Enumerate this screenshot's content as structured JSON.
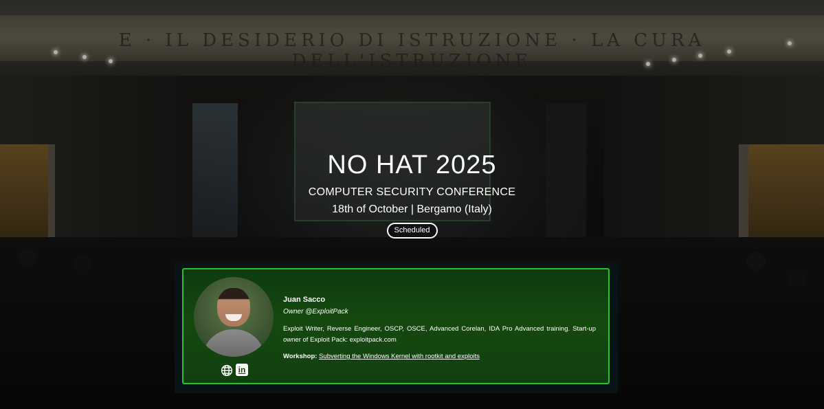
{
  "background": {
    "frieze_text": "E · IL DESIDERIO DI ISTRUZIONE · LA CURA DELL'ISTRUZIONE"
  },
  "hero": {
    "title": "NO HAT 2025",
    "subtitle": "COMPUTER SECURITY CONFERENCE",
    "date_location": "18th of October | Bergamo (Italy)",
    "status_badge": "Scheduled"
  },
  "speaker": {
    "name": "Juan Sacco",
    "role": "Owner @ExploitPack",
    "bio": "Exploit Writer, Reverse Engineer, OSCP, OSCE, Advanced Corelan, IDA Pro Advanced training. Start-up owner of Exploit Pack: exploitpack.com",
    "workshop_label": "Workshop:",
    "workshop_title": "Subverting the Windows Kernel with rootkit and exploits",
    "social_links": [
      "globe-icon",
      "linkedin-icon"
    ],
    "linkedin_glyph": "in"
  },
  "colors": {
    "card_border": "#2bbf2e",
    "card_bg": "#15490f",
    "text": "#ffffff"
  }
}
